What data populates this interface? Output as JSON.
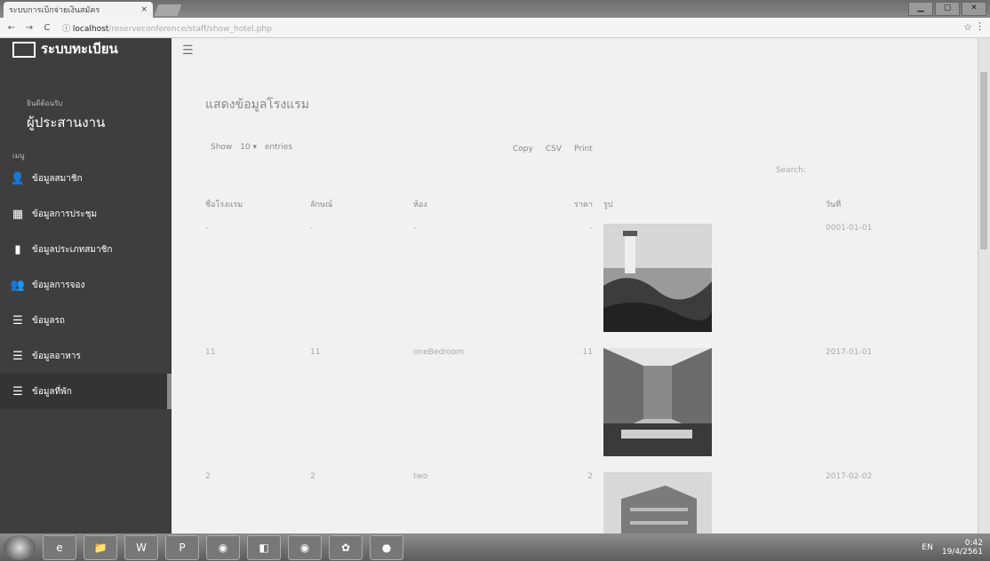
{
  "browser": {
    "tab_title": "ระบบการเบิกจ่ายเงินสมัคร",
    "tab_close": "×",
    "url_host": "localhost",
    "url_path": "/reserveconference/staff/show_hotel.php",
    "url_icon": "ⓘ",
    "back_icon": "←",
    "forward_icon": "→",
    "reload_icon": "C",
    "star_icon": "☆",
    "menu_icon": "⋮",
    "window_buttons": [
      "▁",
      "▢",
      "✕"
    ]
  },
  "sidebar": {
    "brand": "ระบบทะเบียน",
    "welcome_label": "ยินดีต้อนรับ",
    "role": "ผู้ประสานงาน",
    "menu_label": "เมนู",
    "items": [
      {
        "label": "ข้อมูลสมาชิก",
        "icon": "user-icon",
        "glyph": "👤"
      },
      {
        "label": "ข้อมูลการประชุม",
        "icon": "calendar-icon",
        "glyph": "▦"
      },
      {
        "label": "ข้อมูลประเภทสมาชิก",
        "icon": "file-icon",
        "glyph": "▮"
      },
      {
        "label": "ข้อมูลการจอง",
        "icon": "users-icon",
        "glyph": "👥"
      },
      {
        "label": "ข้อมูลรถ",
        "icon": "list-icon",
        "glyph": "☰"
      },
      {
        "label": "ข้อมูลอาหาร",
        "icon": "list-icon",
        "glyph": "☰"
      },
      {
        "label": "ข้อมูลที่พัก",
        "icon": "list-icon",
        "glyph": "☰"
      }
    ]
  },
  "main": {
    "hamburger": "☰",
    "title": "แสดงข้อมูลโรงแรม",
    "show_label": "Show",
    "show_value": "10",
    "show_entries": "entries",
    "exports": [
      "Copy",
      "CSV",
      "Print"
    ],
    "search_label": "Search:",
    "columns": [
      "ชื่อโรงแรม",
      "ลักษณ์",
      "ห้อง",
      "ราคา",
      "รูป",
      "วันที่"
    ],
    "rows": [
      {
        "name": "-",
        "star": "-",
        "room": "-",
        "price": "-",
        "date": "0001-01-01"
      },
      {
        "name": "11",
        "star": "11",
        "room": "oneBedroom",
        "price": "11",
        "date": "2017-01-01"
      },
      {
        "name": "2",
        "star": "2",
        "room": "two",
        "price": "2",
        "date": "2017-02-02"
      }
    ]
  },
  "taskbar": {
    "apps": [
      "e",
      "📁",
      "W",
      "P",
      "◉",
      "◧",
      "◉",
      "✿",
      "●"
    ],
    "lang": "EN",
    "time": "0:42",
    "date": "19/4/2561"
  }
}
